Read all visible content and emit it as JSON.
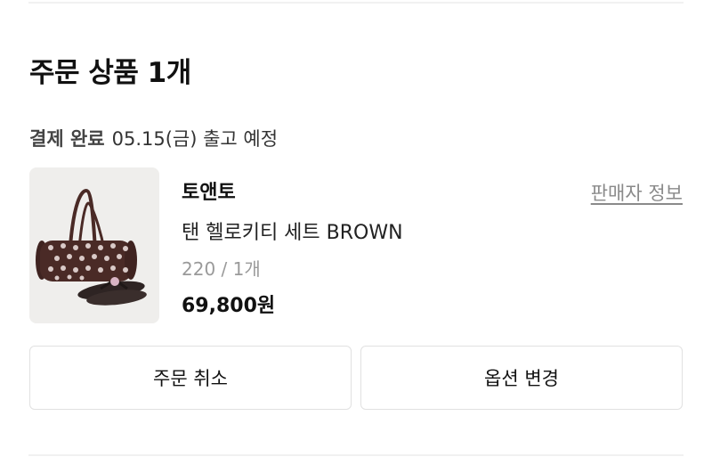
{
  "section": {
    "title": "주문 상품 1개"
  },
  "order": {
    "status": "결제 완료",
    "ship_info": "05.15(금) 출고 예정"
  },
  "product": {
    "brand": "토앤토",
    "name": "탠 헬로키티 세트 BROWN",
    "option": "220 / 1개",
    "price": "69,800원",
    "image_icon": "bag-and-flip-flop-image"
  },
  "seller": {
    "link_label": "판매자 정보"
  },
  "actions": {
    "cancel_label": "주문 취소",
    "change_option_label": "옵션 변경"
  },
  "colors": {
    "border": "#e1e1e1",
    "muted_text": "#8a8a8a",
    "thumb_bg": "#efeeec",
    "product_brown": "#4a2a26"
  }
}
